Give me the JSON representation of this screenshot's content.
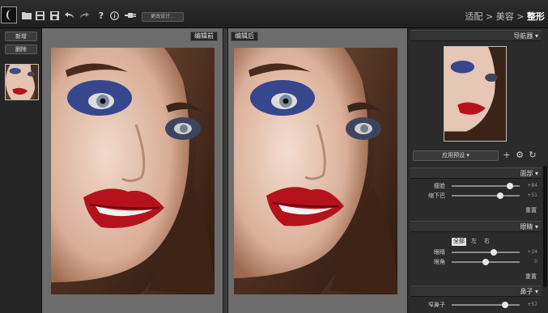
{
  "toolbar": {
    "icons": [
      "logo-icon",
      "open-folder-icon",
      "save-icon",
      "save-as-icon",
      "undo-icon",
      "redo-icon",
      "help-icon",
      "info-icon",
      "plugin-icon"
    ],
    "button_label": "更改设计...",
    "breadcrumb": {
      "item1": "适配",
      "sep1": ">",
      "item2": "美容",
      "sep2": ">",
      "current": "整形"
    }
  },
  "left_panel": {
    "new_label": "新增",
    "delete_label": "删除"
  },
  "panes": {
    "before_label": "编辑前",
    "after_label": "编辑后"
  },
  "right_panel": {
    "navigator_title": "导航器",
    "preset": {
      "label": "应用预设"
    },
    "face": {
      "title": "面部",
      "sliders": [
        {
          "label": "瘦脸",
          "value": "+84",
          "level": 0.86
        },
        {
          "label": "缩下巴",
          "value": "+51",
          "level": 0.72
        }
      ],
      "reset_label": "重置"
    },
    "eyes": {
      "title": "眼睛",
      "modes": [
        "全部",
        "左",
        "右"
      ],
      "selected_mode": "全部",
      "sliders": [
        {
          "label": "眼睛",
          "value": "+24",
          "level": 0.62
        },
        {
          "label": "眼角",
          "value": "0",
          "level": 0.5
        }
      ],
      "reset_label": "重置"
    },
    "nose": {
      "title": "鼻子",
      "sliders": [
        {
          "label": "窄鼻子",
          "value": "+57",
          "level": 0.78
        }
      ]
    }
  },
  "colors": {
    "background": "#1e1e1e",
    "panel": "#2b2b2b",
    "canvas": "#6c6c6c",
    "accent_lips": "#b5121b"
  }
}
